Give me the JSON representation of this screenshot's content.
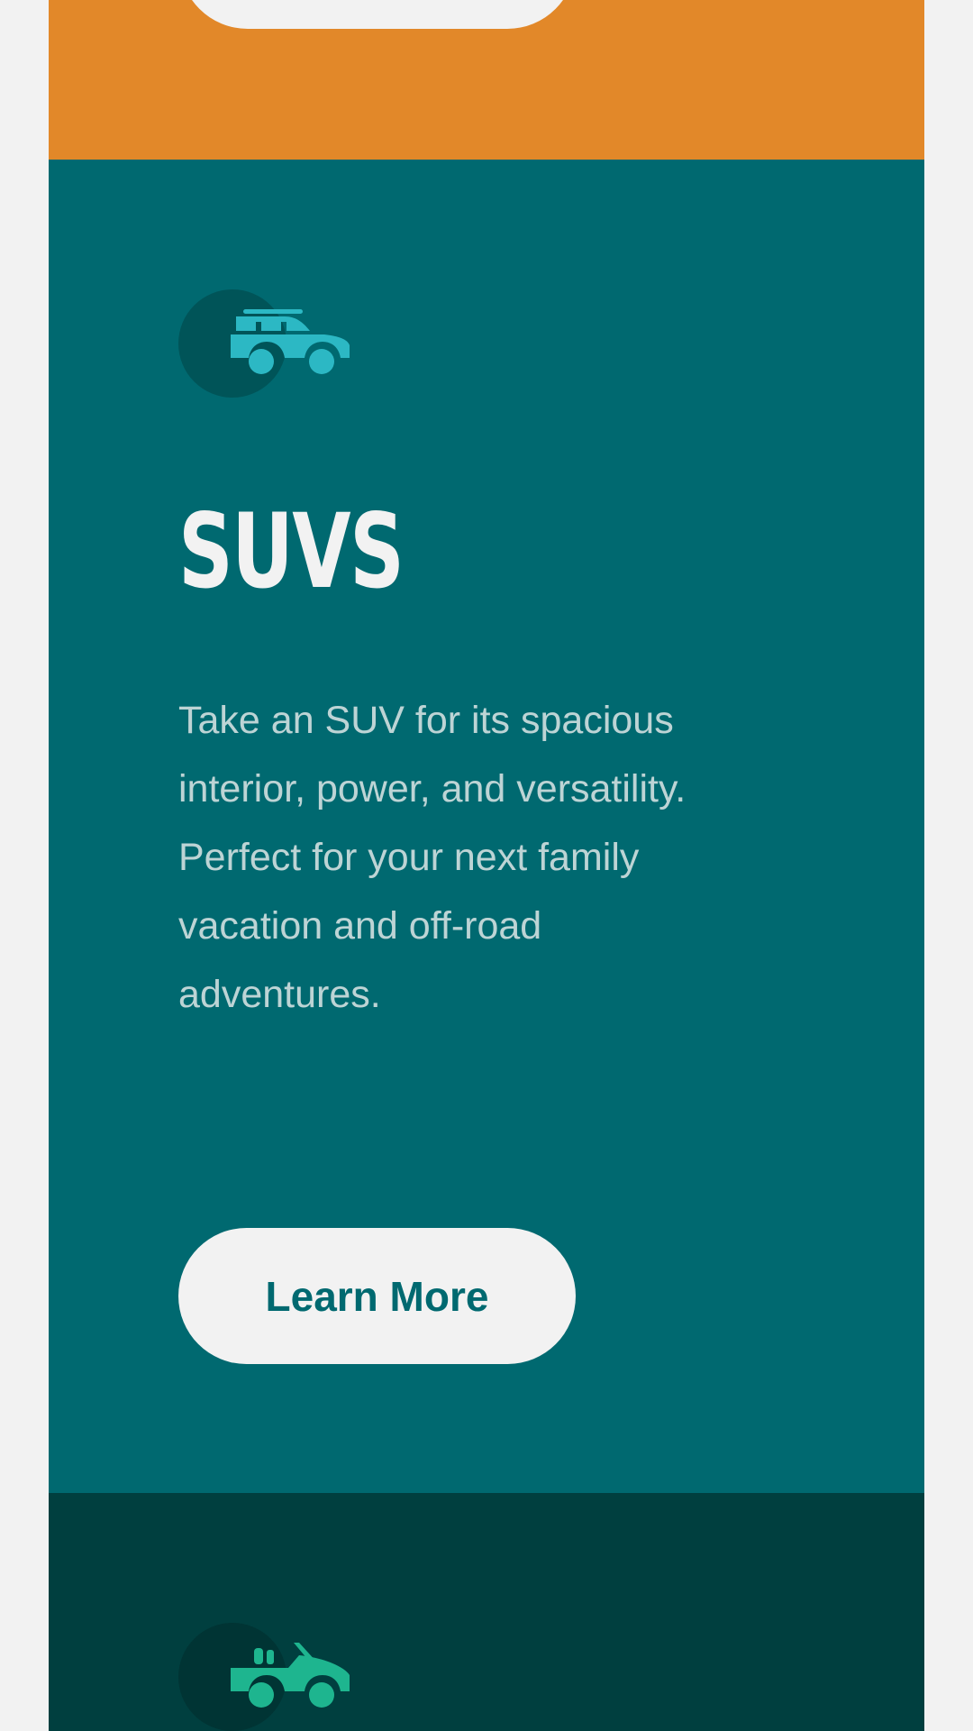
{
  "colors": {
    "background": "#f2f2f2",
    "sedans_panel": "#e28829",
    "suvs_panel": "#006970",
    "luxury_panel": "#003f3f",
    "suvs_icon": "#2cb8c4",
    "luxury_icon": "#1eb58f",
    "text_light": "#f2f2f2"
  },
  "cards": [
    {
      "id": "suvs",
      "icon": "suv-car-icon",
      "heading": "SUVs",
      "description_lines": [
        "Take an SUV for its spacious",
        "interior, power, and versatility.",
        "Perfect for your next family",
        "vacation and off-road",
        "adventures."
      ],
      "button_label": "Learn More"
    },
    {
      "id": "luxury",
      "icon": "convertible-car-icon"
    }
  ]
}
